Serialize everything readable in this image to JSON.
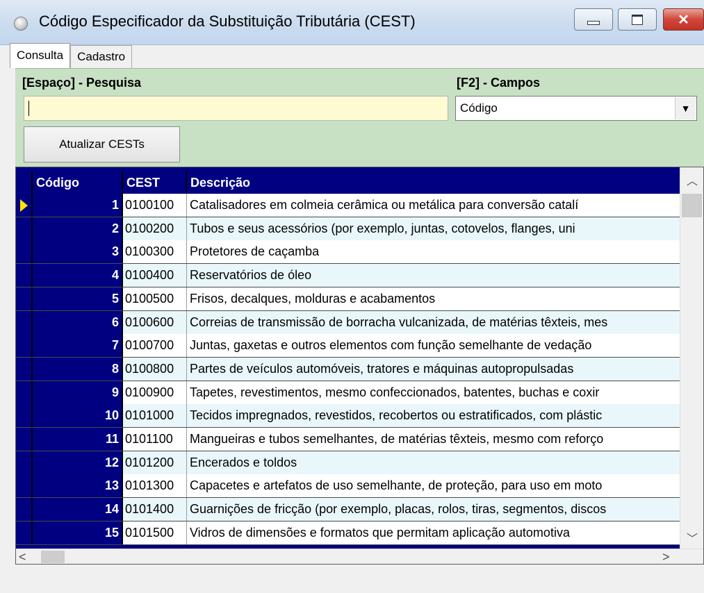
{
  "window": {
    "title": "Código Especificador da Substituição Tributária (CEST)",
    "close_glyph": "✕"
  },
  "tabs": [
    {
      "label": "Consulta",
      "active": true
    },
    {
      "label": "Cadastro",
      "active": false
    }
  ],
  "search": {
    "label": "[Espaço] - Pesquisa",
    "value": ""
  },
  "fields": {
    "label": "[F2] - Campos",
    "selected": "Código"
  },
  "actions": {
    "update_label": "Atualizar CESTs"
  },
  "grid": {
    "columns": [
      "Código",
      "CEST",
      "Descrição"
    ],
    "rows": [
      {
        "codigo": "1",
        "cest": "0100100",
        "descricao": "Catalisadores em colmeia cerâmica ou metálica para conversão catalí"
      },
      {
        "codigo": "2",
        "cest": "0100200",
        "descricao": "Tubos e seus acessórios (por exemplo, juntas, cotovelos, flanges, uni"
      },
      {
        "codigo": "3",
        "cest": "0100300",
        "descricao": "Protetores de caçamba"
      },
      {
        "codigo": "4",
        "cest": "0100400",
        "descricao": "Reservatórios de óleo"
      },
      {
        "codigo": "5",
        "cest": "0100500",
        "descricao": "Frisos, decalques, molduras e acabamentos"
      },
      {
        "codigo": "6",
        "cest": "0100600",
        "descricao": "Correias de transmissão de borracha vulcanizada, de matérias têxteis, mes"
      },
      {
        "codigo": "7",
        "cest": "0100700",
        "descricao": "Juntas, gaxetas e outros elementos com função semelhante de vedação"
      },
      {
        "codigo": "8",
        "cest": "0100800",
        "descricao": "Partes de veículos automóveis, tratores e máquinas autopropulsadas"
      },
      {
        "codigo": "9",
        "cest": "0100900",
        "descricao": "Tapetes, revestimentos, mesmo confeccionados, batentes, buchas e coxir"
      },
      {
        "codigo": "10",
        "cest": "0101000",
        "descricao": "Tecidos impregnados, revestidos, recobertos ou estratificados, com plástic"
      },
      {
        "codigo": "11",
        "cest": "0101100",
        "descricao": "Mangueiras e tubos semelhantes, de matérias têxteis, mesmo com reforço"
      },
      {
        "codigo": "12",
        "cest": "0101200",
        "descricao": "Encerados e toldos"
      },
      {
        "codigo": "13",
        "cest": "0101300",
        "descricao": "Capacetes e artefatos de uso semelhante, de proteção, para uso em moto"
      },
      {
        "codigo": "14",
        "cest": "0101400",
        "descricao": "Guarnições de fricção (por exemplo, placas, rolos, tiras, segmentos, discos"
      },
      {
        "codigo": "15",
        "cest": "0101500",
        "descricao": "Vidros de dimensões e formatos que permitam aplicação automotiva"
      }
    ]
  },
  "colors": {
    "header_navy": "#000080",
    "panel_green": "#c8e0c4",
    "search_yellow": "#fefbd2",
    "row_alt": "#e9f7fb",
    "row_pointer": "#ffe400"
  }
}
